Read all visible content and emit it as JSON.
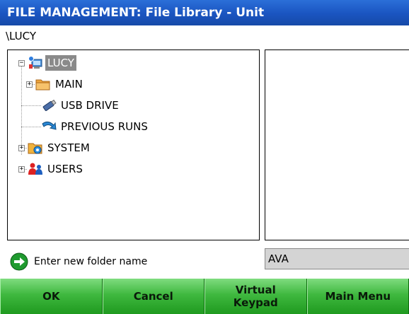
{
  "window": {
    "title": "FILE MANAGEMENT: File Library - Unit"
  },
  "path": "\\LUCY",
  "tree": [
    {
      "label": "LUCY",
      "icon": "network-computer-icon",
      "selected": true,
      "expander": "−"
    },
    {
      "label": "MAIN",
      "icon": "folder-icon",
      "expander": "+"
    },
    {
      "label": "USB DRIVE",
      "icon": "usb-drive-icon"
    },
    {
      "label": "PREVIOUS RUNS",
      "icon": "previous-runs-icon"
    },
    {
      "label": "SYSTEM",
      "icon": "system-icon",
      "expander": "+"
    },
    {
      "label": "USERS",
      "icon": "users-icon",
      "expander": "+"
    }
  ],
  "hint": {
    "text": "Enter new folder name",
    "icon": "green-arrow-icon"
  },
  "folder_name": {
    "value": "AVA"
  },
  "softkeys": [
    {
      "label": "OK"
    },
    {
      "label": "Cancel"
    },
    {
      "label": "Virtual\nKeypad"
    },
    {
      "label": "Main Menu"
    }
  ]
}
